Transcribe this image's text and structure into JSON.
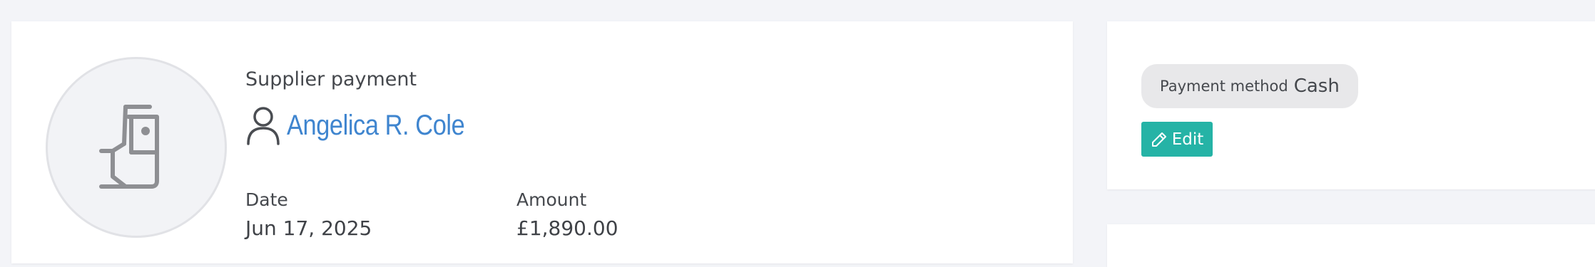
{
  "payment": {
    "kind": "Supplier payment",
    "payee_name": "Angelica R. Cole",
    "date_label": "Date",
    "date_value": "Jun 17, 2025",
    "amount_label": "Amount",
    "amount_value": "£1,890.00"
  },
  "side": {
    "method_label": "Payment method",
    "method_value": "Cash",
    "edit_label": "Edit"
  },
  "icons": {
    "avatar": "cash-register-icon",
    "payee": "person-icon",
    "edit": "pencil-icon"
  },
  "colors": {
    "background": "#f3f4f8",
    "link": "#3f85cf",
    "edit_button": "#25b3a6",
    "pill": "#e8e8ea"
  }
}
